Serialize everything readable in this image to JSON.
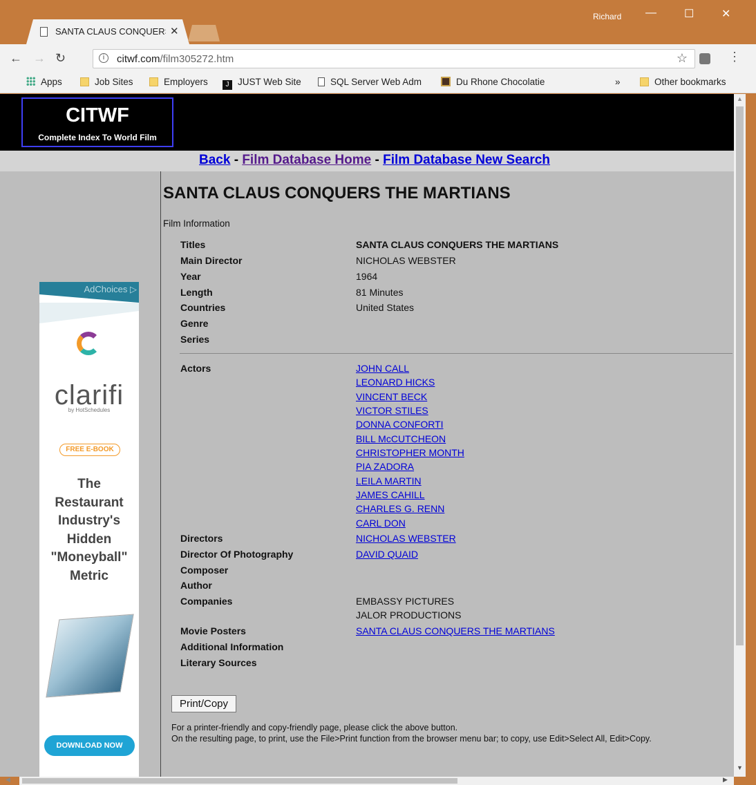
{
  "browser": {
    "tab_title": "SANTA CLAUS CONQUERS THE MARTIANS",
    "tab_close": "✕",
    "profile_name": "Richard",
    "url_host": "citwf.com",
    "url_path": "/film305272.htm",
    "bookmarks": [
      "Apps",
      "Job Sites",
      "Employers",
      "JUST Web Site",
      "SQL Server Web Adm",
      "Du Rhone Chocolatie",
      "»",
      "Other bookmarks"
    ]
  },
  "site": {
    "logo_title": "CITWF",
    "logo_subtitle": "Complete Index To World Film",
    "nav": {
      "back": "Back",
      "sep1": " - ",
      "home": "Film Database Home",
      "sep2": " - ",
      "new_search": "Film Database New Search"
    }
  },
  "ad": {
    "adchoices": "AdChoices ▷",
    "brand": "clarifi",
    "by_line": "by HotSchedules",
    "ebook": "FREE E-BOOK",
    "headline_lines": [
      "The",
      "Restaurant",
      "Industry's",
      "Hidden",
      "\"Moneyball\"",
      "Metric"
    ],
    "cta": "DOWNLOAD NOW"
  },
  "film": {
    "title": "SANTA CLAUS CONQUERS THE MARTIANS",
    "section": "Film Information",
    "labels": {
      "titles": "Titles",
      "main_director": "Main Director",
      "year": "Year",
      "length": "Length",
      "countries": "Countries",
      "genre": "Genre",
      "series": "Series",
      "actors": "Actors",
      "directors": "Directors",
      "dop": "Director Of Photography",
      "composer": "Composer",
      "author": "Author",
      "companies": "Companies",
      "posters": "Movie Posters",
      "additional": "Additional Information",
      "literary": "Literary Sources"
    },
    "titles": "SANTA CLAUS CONQUERS THE MARTIANS",
    "main_director": "NICHOLAS WEBSTER",
    "year": "1964",
    "length": "81 Minutes",
    "countries": "United States",
    "actors": [
      "JOHN CALL",
      "LEONARD HICKS",
      "VINCENT BECK",
      "VICTOR STILES",
      "DONNA CONFORTI",
      "BILL McCUTCHEON",
      "CHRISTOPHER MONTH",
      "PIA ZADORA",
      "LEILA MARTIN",
      "JAMES CAHILL",
      "CHARLES G. RENN",
      "CARL DON"
    ],
    "directors": "NICHOLAS WEBSTER",
    "dop": "DAVID QUAID",
    "companies": [
      "EMBASSY PICTURES",
      "JALOR PRODUCTIONS"
    ],
    "posters": "SANTA CLAUS CONQUERS THE MARTIANS"
  },
  "print": {
    "button": "Print/Copy",
    "note1": "For a printer-friendly and copy-friendly page, please click the above button.",
    "note2": "On the resulting page, to print, use the File>Print function from the browser menu bar; to copy, use Edit>Select All, Edit>Copy."
  }
}
